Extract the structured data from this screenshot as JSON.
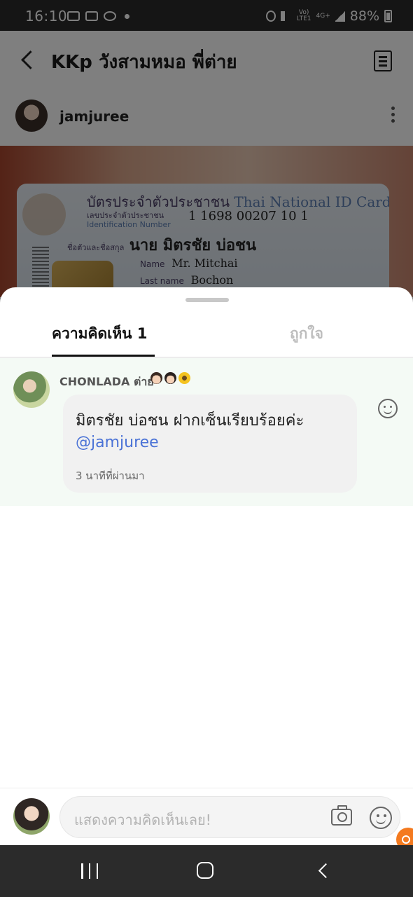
{
  "status_bar": {
    "time": "16:10",
    "network_label_top": "Vo)",
    "network_label_bottom": "LTE1",
    "data_label": "4G+",
    "battery": "88%"
  },
  "post": {
    "title": "KKp วังสามหมอ พี่ต่าย",
    "author": "jamjuree",
    "id_card": {
      "title_th": "บัตรประจำตัวประชาชน",
      "title_en": "Thai National ID Card",
      "number_label_th": "เลขประจำตัวประชาชน",
      "number_label_en": "Identification Number",
      "number": "1 1698 00207 10 1",
      "name_label_th": "ชื่อตัวและชื่อสกุล",
      "name_th": "นาย มิตรชัย บ่อชน",
      "name_label_en": "Name",
      "name_en": "Mr. Mitchai",
      "last_name_label_en": "Last name",
      "last_name_en": "Bochon"
    }
  },
  "sheet": {
    "tabs": [
      {
        "label": "ความคิดเห็น 1",
        "active": true
      },
      {
        "label": "ถูกใจ",
        "active": false
      }
    ]
  },
  "comment": {
    "author": "CHONLADA ต่าย",
    "emojis": [
      "man-emoji",
      "woman-emoji",
      "sunflower-emoji"
    ],
    "text": "มิตรชัย บ่อชน ฝากเซ็นเรียบร้อยค่ะ",
    "mention": "@jamjuree",
    "time": "3 นาทีที่ผ่านมา"
  },
  "input": {
    "placeholder": "แสดงความคิดเห็นเลย!"
  },
  "colors": {
    "mention": "#4a72d6",
    "comment_highlight_bg": "#f4faf5",
    "floating_icon": "#f47a1f",
    "system_bars": "#2b2b2b"
  }
}
